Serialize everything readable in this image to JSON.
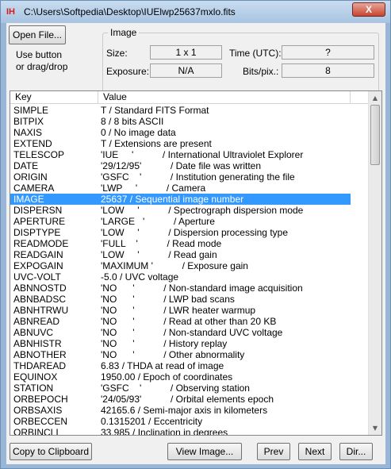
{
  "window": {
    "icon_text": "IH",
    "title": "C:\\Users\\Softpedia\\Desktop\\IUElwp25637mxlo.fits",
    "close_label": "X"
  },
  "open": {
    "button_label": "Open File...",
    "hint_line1": "Use button",
    "hint_line2": "or drag/drop"
  },
  "image": {
    "group_label": "Image",
    "size_label": "Size:",
    "size_value": "1 x 1",
    "time_label": "Time (UTC):",
    "time_value": "?",
    "exposure_label": "Exposure:",
    "exposure_value": "N/A",
    "bits_label": "Bits/pix.:",
    "bits_value": "8"
  },
  "table": {
    "headers": [
      "Key",
      "Value"
    ],
    "rows": [
      {
        "key": "SIMPLE",
        "value": "T / Standard FITS Format"
      },
      {
        "key": "BITPIX",
        "value": "8 / 8 bits ASCII"
      },
      {
        "key": "NAXIS",
        "value": "0 / No image data"
      },
      {
        "key": "EXTEND",
        "value": "T / Extensions are present"
      },
      {
        "key": "TELESCOP",
        "value": "'IUE     '           / International Ultraviolet Explorer"
      },
      {
        "key": "DATE",
        "value": "'29/12/95'           / Date file was written"
      },
      {
        "key": "ORIGIN",
        "value": "'GSFC    '           / Institution generating the file"
      },
      {
        "key": "CAMERA",
        "value": "'LWP     '           / Camera"
      },
      {
        "key": "IMAGE",
        "value": "25637 / Sequential image number"
      },
      {
        "key": "DISPERSN",
        "value": "'LOW     '           / Spectrograph dispersion mode"
      },
      {
        "key": "APERTURE",
        "value": "'LARGE   '           / Aperture"
      },
      {
        "key": "DISPTYPE",
        "value": "'LOW     '           / Dispersion processing type"
      },
      {
        "key": "READMODE",
        "value": "'FULL    '           / Read mode"
      },
      {
        "key": "READGAIN",
        "value": "'LOW     '           / Read gain"
      },
      {
        "key": "EXPOGAIN",
        "value": "'MAXIMUM '           / Exposure gain"
      },
      {
        "key": "UVC-VOLT",
        "value": "-5.0 / UVC voltage"
      },
      {
        "key": "ABNNOSTD",
        "value": "'NO      '           / Non-standard image acquisition"
      },
      {
        "key": "ABNBADSC",
        "value": "'NO      '           / LWP bad scans"
      },
      {
        "key": "ABNHTRWU",
        "value": "'NO      '           / LWR heater warmup"
      },
      {
        "key": "ABNREAD",
        "value": "'NO      '           / Read at other than 20 KB"
      },
      {
        "key": "ABNUVC",
        "value": "'NO      '           / Non-standard UVC voltage"
      },
      {
        "key": "ABNHISTR",
        "value": "'NO      '           / History replay"
      },
      {
        "key": "ABNOTHER",
        "value": "'NO      '           / Other abnormality"
      },
      {
        "key": "THDAREAD",
        "value": "6.83 / THDA at read of image"
      },
      {
        "key": "EQUINOX",
        "value": "1950.00 / Epoch of coordinates"
      },
      {
        "key": "STATION",
        "value": "'GSFC    '           / Observing station"
      },
      {
        "key": "ORBEPOCH",
        "value": "'24/05/93'           / Orbital elements epoch"
      },
      {
        "key": "ORBSAXIS",
        "value": "42165.6 / Semi-major axis in kilometers"
      },
      {
        "key": "ORBECCEN",
        "value": "0.1315201 / Eccentricity"
      },
      {
        "key": "ORBINCLI",
        "value": "33.985 / Inclination in degrees"
      }
    ],
    "selected_index": 8
  },
  "buttons": {
    "copy": "Copy to Clipboard",
    "view": "View Image...",
    "prev": "Prev",
    "next": "Next",
    "dir": "Dir..."
  }
}
